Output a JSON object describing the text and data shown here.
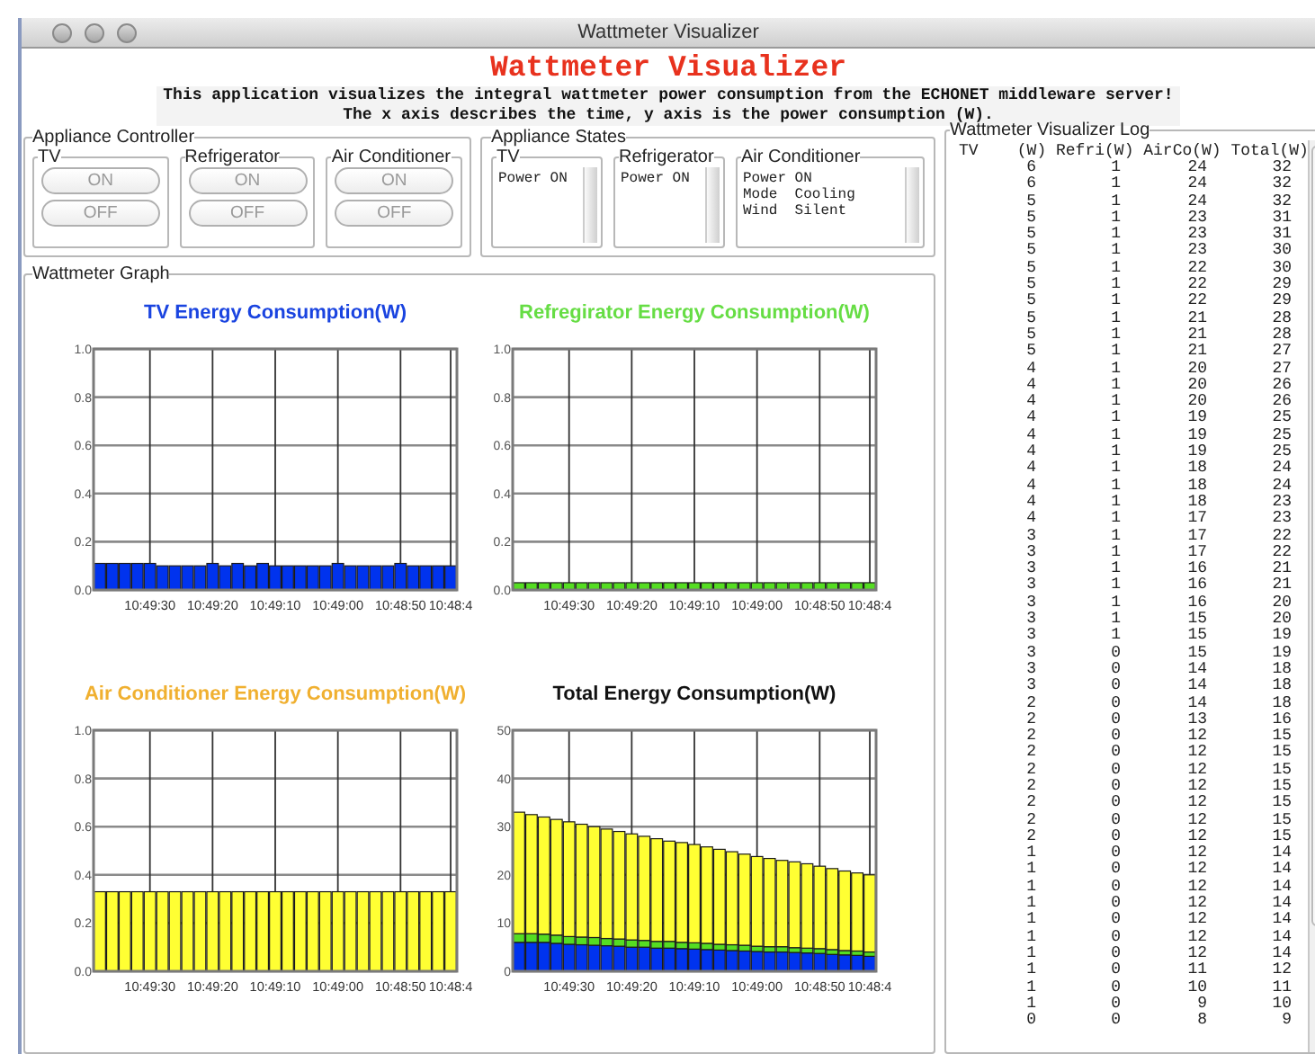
{
  "window": {
    "title": "Wattmeter Visualizer"
  },
  "header": {
    "title": "Wattmeter Visualizer",
    "description": [
      "This application visualizes the integral wattmeter power consumption from the ECHONET middleware server!",
      "The x axis describes the time, y axis is the power consumption (W)."
    ]
  },
  "controller": {
    "title": "Appliance Controller",
    "appliances": [
      {
        "name": "TV",
        "buttons": [
          "ON",
          "OFF"
        ]
      },
      {
        "name": "Refrigerator",
        "buttons": [
          "ON",
          "OFF"
        ]
      },
      {
        "name": "Air Conditioner",
        "buttons": [
          "ON",
          "OFF"
        ]
      }
    ]
  },
  "states": {
    "title": "Appliance States",
    "appliances": [
      {
        "name": "TV",
        "lines": [
          "Power ON"
        ]
      },
      {
        "name": "Refrigerator",
        "lines": [
          "Power ON"
        ]
      },
      {
        "name": "Air Conditioner",
        "lines": [
          "Power ON",
          "Mode  Cooling",
          "Wind  Silent"
        ]
      }
    ]
  },
  "graph": {
    "title": "Wattmeter Graph",
    "charts": [
      {
        "chart_data": {
          "type": "bar",
          "grid": true,
          "title": "TV Energy Consumption(W)",
          "categories": [
            null,
            null,
            null,
            null,
            "10:49:30",
            null,
            null,
            null,
            null,
            "10:49:20",
            null,
            null,
            null,
            null,
            "10:49:10",
            null,
            null,
            null,
            null,
            "10:49:00",
            null,
            null,
            null,
            null,
            "10:48:50",
            null,
            null,
            null,
            "10:48:4"
          ],
          "ylim": [
            0,
            1
          ],
          "yticks": [
            {
              "value": 0,
              "label": "0.0"
            },
            {
              "value": 0.2,
              "label": "0.2"
            },
            {
              "value": 0.4,
              "label": "0.4"
            },
            {
              "value": 0.6,
              "label": "0.6"
            },
            {
              "value": 0.8,
              "label": "0.8"
            },
            {
              "value": 1,
              "label": "1.0"
            }
          ],
          "series": [
            {
              "color": "#0033ee",
              "values": [
                0.11,
                0.11,
                0.11,
                0.11,
                0.11,
                0.1,
                0.1,
                0.1,
                0.1,
                0.11,
                0.1,
                0.11,
                0.1,
                0.11,
                0.1,
                0.1,
                0.1,
                0.1,
                0.1,
                0.11,
                0.1,
                0.1,
                0.1,
                0.1,
                0.11,
                0.1,
                0.1,
                0.1,
                0.1
              ]
            }
          ]
        }
      },
      {
        "chart_data": {
          "type": "bar",
          "grid": true,
          "title": "Refregirator Energy Consumption(W)",
          "categories": [
            null,
            null,
            null,
            null,
            "10:49:30",
            null,
            null,
            null,
            null,
            "10:49:20",
            null,
            null,
            null,
            null,
            "10:49:10",
            null,
            null,
            null,
            null,
            "10:49:00",
            null,
            null,
            null,
            null,
            "10:48:50",
            null,
            null,
            null,
            "10:48:4"
          ],
          "ylim": [
            0,
            1
          ],
          "yticks": [
            {
              "value": 0,
              "label": "0.0"
            },
            {
              "value": 0.2,
              "label": "0.2"
            },
            {
              "value": 0.4,
              "label": "0.4"
            },
            {
              "value": 0.6,
              "label": "0.6"
            },
            {
              "value": 0.8,
              "label": "0.8"
            },
            {
              "value": 1,
              "label": "1.0"
            }
          ],
          "series": [
            {
              "color": "#55dd22",
              "values": [
                0.03,
                0.03,
                0.03,
                0.03,
                0.03,
                0.03,
                0.03,
                0.03,
                0.03,
                0.03,
                0.03,
                0.03,
                0.03,
                0.03,
                0.03,
                0.03,
                0.03,
                0.03,
                0.03,
                0.03,
                0.03,
                0.03,
                0.03,
                0.03,
                0.03,
                0.03,
                0.03,
                0.03,
                0.03
              ]
            }
          ]
        }
      },
      {
        "chart_data": {
          "type": "bar",
          "grid": true,
          "title": "Air Conditioner Energy Consumption(W)",
          "categories": [
            null,
            null,
            null,
            null,
            "10:49:30",
            null,
            null,
            null,
            null,
            "10:49:20",
            null,
            null,
            null,
            null,
            "10:49:10",
            null,
            null,
            null,
            null,
            "10:49:00",
            null,
            null,
            null,
            null,
            "10:48:50",
            null,
            null,
            null,
            "10:48:4"
          ],
          "ylim": [
            0,
            1
          ],
          "yticks": [
            {
              "value": 0,
              "label": "0.0"
            },
            {
              "value": 0.2,
              "label": "0.2"
            },
            {
              "value": 0.4,
              "label": "0.4"
            },
            {
              "value": 0.6,
              "label": "0.6"
            },
            {
              "value": 0.8,
              "label": "0.8"
            },
            {
              "value": 1,
              "label": "1.0"
            }
          ],
          "series": [
            {
              "color": "#ffff33",
              "values": [
                0.33,
                0.33,
                0.33,
                0.33,
                0.33,
                0.33,
                0.33,
                0.33,
                0.33,
                0.33,
                0.33,
                0.33,
                0.33,
                0.33,
                0.33,
                0.33,
                0.33,
                0.33,
                0.33,
                0.33,
                0.33,
                0.33,
                0.33,
                0.33,
                0.33,
                0.33,
                0.33,
                0.33,
                0.33
              ]
            }
          ]
        }
      },
      {
        "chart_data": {
          "type": "bar",
          "grid": true,
          "title": "Total Energy Consumption(W)",
          "stacked": true,
          "categories": [
            null,
            null,
            null,
            null,
            "10:49:30",
            null,
            null,
            null,
            null,
            "10:49:20",
            null,
            null,
            null,
            null,
            "10:49:10",
            null,
            null,
            null,
            null,
            "10:49:00",
            null,
            null,
            null,
            null,
            "10:48:50",
            null,
            null,
            null,
            "10:48:4"
          ],
          "ylim": [
            0,
            50
          ],
          "yticks": [
            0,
            10,
            20,
            30,
            40,
            50
          ],
          "series": [
            {
              "color": "#0033ee",
              "values": [
                6,
                6,
                6,
                5.8,
                5.6,
                5.5,
                5.4,
                5.3,
                5.2,
                5,
                5,
                4.8,
                4.8,
                4.7,
                4.6,
                4.5,
                4.4,
                4.3,
                4.2,
                4.1,
                4,
                4,
                3.9,
                3.8,
                3.7,
                3.5,
                3.4,
                3.3,
                3.1
              ]
            },
            {
              "color": "#55dd22",
              "values": [
                1.8,
                1.8,
                1.7,
                1.7,
                1.6,
                1.6,
                1.6,
                1.5,
                1.5,
                1.5,
                1.4,
                1.4,
                1.4,
                1.3,
                1.3,
                1.3,
                1.2,
                1.2,
                1.2,
                1.1,
                1.1,
                1.1,
                1,
                1,
                1,
                1,
                0.9,
                0.9,
                0.9
              ]
            },
            {
              "color": "#ffff33",
              "values": [
                25.2,
                24.7,
                24.3,
                24,
                23.8,
                23.4,
                23,
                22.7,
                22.3,
                22,
                21.6,
                21.3,
                20.8,
                20.7,
                20.4,
                20,
                19.7,
                19.3,
                18.9,
                18.6,
                18.3,
                17.9,
                17.8,
                17.5,
                17.1,
                16.8,
                16.5,
                16.2,
                16
              ]
            }
          ]
        }
      }
    ]
  },
  "log": {
    "title": "Wattmeter Visualizer Log",
    "header": "TV    (W) Refri(W) AirCo(W) Total(W)",
    "rows": [
      [
        "6",
        "1",
        "24",
        "32"
      ],
      [
        "6",
        "1",
        "24",
        "32"
      ],
      [
        "5",
        "1",
        "24",
        "32"
      ],
      [
        "5",
        "1",
        "23",
        "31"
      ],
      [
        "5",
        "1",
        "23",
        "31"
      ],
      [
        "5",
        "1",
        "23",
        "30"
      ],
      [
        "5",
        "1",
        "22",
        "30"
      ],
      [
        "5",
        "1",
        "22",
        "29"
      ],
      [
        "5",
        "1",
        "22",
        "29"
      ],
      [
        "5",
        "1",
        "21",
        "28"
      ],
      [
        "5",
        "1",
        "21",
        "28"
      ],
      [
        "5",
        "1",
        "21",
        "27"
      ],
      [
        "4",
        "1",
        "20",
        "27"
      ],
      [
        "4",
        "1",
        "20",
        "26"
      ],
      [
        "4",
        "1",
        "20",
        "26"
      ],
      [
        "4",
        "1",
        "19",
        "25"
      ],
      [
        "4",
        "1",
        "19",
        "25"
      ],
      [
        "4",
        "1",
        "19",
        "25"
      ],
      [
        "4",
        "1",
        "18",
        "24"
      ],
      [
        "4",
        "1",
        "18",
        "24"
      ],
      [
        "4",
        "1",
        "18",
        "23"
      ],
      [
        "4",
        "1",
        "17",
        "23"
      ],
      [
        "3",
        "1",
        "17",
        "22"
      ],
      [
        "3",
        "1",
        "17",
        "22"
      ],
      [
        "3",
        "1",
        "16",
        "21"
      ],
      [
        "3",
        "1",
        "16",
        "21"
      ],
      [
        "3",
        "1",
        "16",
        "20"
      ],
      [
        "3",
        "1",
        "15",
        "20"
      ],
      [
        "3",
        "1",
        "15",
        "19"
      ],
      [
        "3",
        "0",
        "15",
        "19"
      ],
      [
        "3",
        "0",
        "14",
        "18"
      ],
      [
        "3",
        "0",
        "14",
        "18"
      ],
      [
        "2",
        "0",
        "14",
        "18"
      ],
      [
        "2",
        "0",
        "13",
        "16"
      ],
      [
        "2",
        "0",
        "12",
        "15"
      ],
      [
        "2",
        "0",
        "12",
        "15"
      ],
      [
        "2",
        "0",
        "12",
        "15"
      ],
      [
        "2",
        "0",
        "12",
        "15"
      ],
      [
        "2",
        "0",
        "12",
        "15"
      ],
      [
        "2",
        "0",
        "12",
        "15"
      ],
      [
        "2",
        "0",
        "12",
        "15"
      ],
      [
        "1",
        "0",
        "12",
        "14"
      ],
      [
        "1",
        "0",
        "12",
        "14"
      ],
      [
        "1",
        "0",
        "12",
        "14"
      ],
      [
        "1",
        "0",
        "12",
        "14"
      ],
      [
        "1",
        "0",
        "12",
        "14"
      ],
      [
        "1",
        "0",
        "12",
        "14"
      ],
      [
        "1",
        "0",
        "12",
        "14"
      ],
      [
        "1",
        "0",
        "11",
        "12"
      ],
      [
        "1",
        "0",
        "10",
        "11"
      ],
      [
        "1",
        "0",
        "9",
        "10"
      ],
      [
        "0",
        "0",
        "8",
        "9"
      ]
    ]
  }
}
